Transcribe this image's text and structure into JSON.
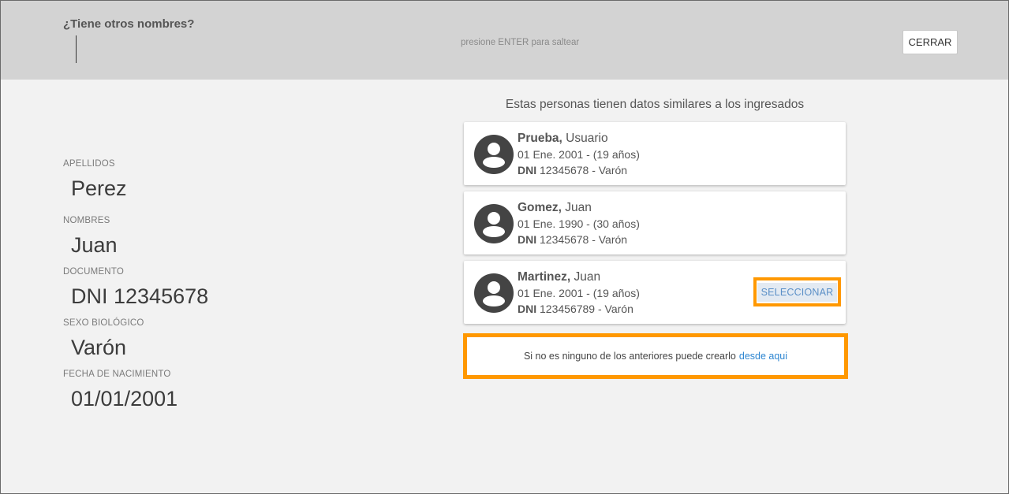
{
  "header": {
    "question": "¿Tiene otros nombres?",
    "hint": "presione ENTER para saltear",
    "close_label": "CERRAR"
  },
  "person": {
    "apellidos_label": "APELLIDOS",
    "apellidos_value": "Perez",
    "nombres_label": "NOMBRES",
    "nombres_value": "Juan",
    "documento_label": "DOCUMENTO",
    "documento_value": "DNI 12345678",
    "sexo_label": "SEXO BIOLÓGICO",
    "sexo_value": "Varón",
    "fecha_label": "FECHA DE NACIMIENTO",
    "fecha_value": "01/01/2001"
  },
  "similar": {
    "title": "Estas personas tienen datos similares a los ingresados",
    "cards": [
      {
        "last_name": "Prueba,",
        "first_name": "Usuario",
        "birth": "01 Ene. 2001 - (19 años)",
        "doc_type": "DNI",
        "doc_rest": "12345678 - Varón"
      },
      {
        "last_name": "Gomez,",
        "first_name": "Juan",
        "birth": "01 Ene. 1990 - (30 años)",
        "doc_type": "DNI",
        "doc_rest": "12345678 - Varón"
      },
      {
        "last_name": "Martinez,",
        "first_name": "Juan",
        "birth": "01 Ene. 2001 - (19 años)",
        "doc_type": "DNI",
        "doc_rest": "123456789 - Varón",
        "select_label": "SELECCIONAR"
      }
    ],
    "create_text": "Si no es ninguno de los anteriores puede crearlo",
    "create_link": "desde aqui"
  },
  "colors": {
    "highlight": "#ff9800",
    "link": "#2e86d1",
    "header_bg": "#d3d3d3",
    "page_bg": "#f2f2f2"
  },
  "icons": {
    "avatar": "person-avatar-icon"
  }
}
